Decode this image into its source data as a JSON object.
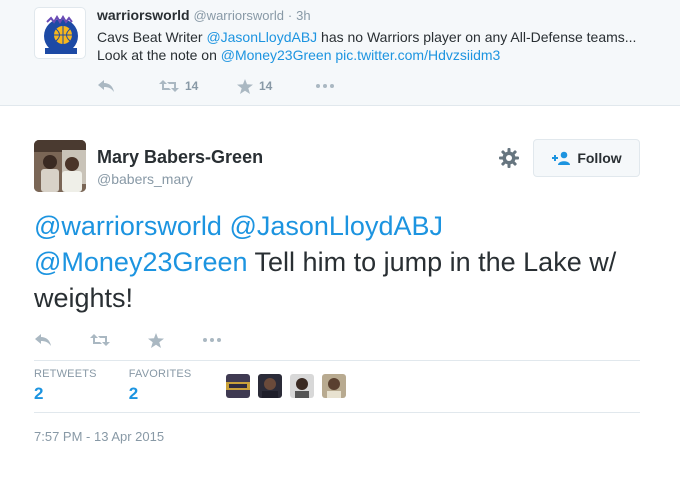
{
  "parent_tweet": {
    "display_name": "warriorsworld",
    "handle": "@warriorsworld",
    "separator": "·",
    "time": "3h",
    "text_parts": {
      "t1": "Cavs Beat Writer ",
      "m1": "@JasonLloydABJ",
      "t2": " has no Warriors player on any All-Defense teams... Look at the note on ",
      "m2": "@Money23Green",
      "t3": " ",
      "link": "pic.twitter.com/Hdvzsiidm3"
    },
    "retweet_count": "14",
    "favorite_count": "14",
    "avatar_logo_text": "WARRIORS WORLD"
  },
  "tweet": {
    "display_name": "Mary Babers-Green",
    "handle": "@babers_mary",
    "follow_label": "Follow",
    "text_parts": {
      "m1": "@warriorsworld",
      "t1": " ",
      "m2": "@JasonLloydABJ",
      "t2": " ",
      "m3": "@Money23Green",
      "t3": " Tell him to jump in the Lake w/ weights!"
    },
    "stats": {
      "retweets_label": "RETWEETS",
      "retweets": "2",
      "favorites_label": "FAVORITES",
      "favorites": "2"
    },
    "timestamp": "7:57 PM - 13 Apr 2015"
  },
  "colors": {
    "link": "#1c94e0",
    "muted": "#8899a6",
    "icon": "#aab8c2",
    "context_bg": "#f5f8fa"
  },
  "icons": [
    "reply-icon",
    "retweet-icon",
    "favorite-icon",
    "more-icon",
    "gear-icon",
    "follow-user-icon"
  ]
}
